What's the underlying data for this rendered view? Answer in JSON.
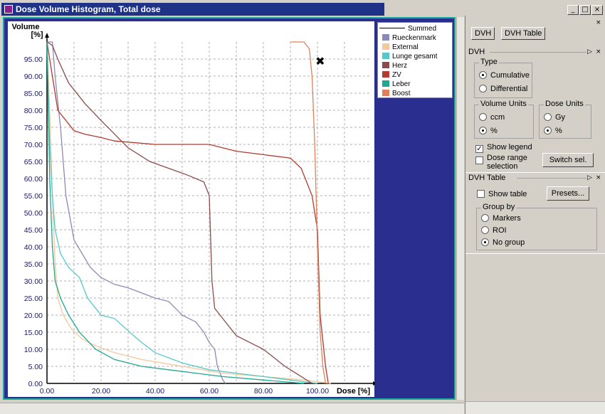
{
  "window": {
    "title": "Dose Volume Histogram, Total dose",
    "min": "_",
    "max": "□",
    "close": "×"
  },
  "chart_data": {
    "type": "line",
    "title": "",
    "xlabel": "Dose [%]",
    "ylabel": "Volume [%]",
    "xlim": [
      0,
      120
    ],
    "ylim": [
      0,
      100
    ],
    "xticks": [
      "0.00",
      "20.00",
      "40.00",
      "60.00",
      "80.00",
      "100.00"
    ],
    "yticks": [
      "0.00",
      "5.00",
      "10.00",
      "15.00",
      "20.00",
      "25.00",
      "30.00",
      "35.00",
      "40.00",
      "45.00",
      "50.00",
      "55.00",
      "60.00",
      "65.00",
      "70.00",
      "75.00",
      "80.00",
      "85.00",
      "90.00",
      "95.00"
    ],
    "grid": true,
    "legend_position": "top-right",
    "legend_title": "Summed",
    "series": [
      {
        "name": "Rueckenmark",
        "color": "#8a8ab8",
        "points": [
          [
            0,
            100
          ],
          [
            2,
            100
          ],
          [
            3,
            90
          ],
          [
            5,
            75
          ],
          [
            7,
            55
          ],
          [
            10,
            42
          ],
          [
            13,
            38
          ],
          [
            16,
            34
          ],
          [
            20,
            31
          ],
          [
            25,
            29
          ],
          [
            30,
            28
          ],
          [
            40,
            25
          ],
          [
            45,
            24
          ],
          [
            50,
            20
          ],
          [
            55,
            18
          ],
          [
            58,
            15
          ],
          [
            60,
            12
          ],
          [
            62,
            10
          ],
          [
            63,
            5
          ],
          [
            64,
            3
          ],
          [
            65,
            1
          ],
          [
            66,
            0
          ]
        ]
      },
      {
        "name": "External",
        "color": "#f4c89a",
        "points": [
          [
            0,
            100
          ],
          [
            1,
            80
          ],
          [
            2,
            55
          ],
          [
            3,
            35
          ],
          [
            4,
            25
          ],
          [
            6,
            20
          ],
          [
            9,
            16
          ],
          [
            13,
            13
          ],
          [
            18,
            11
          ],
          [
            25,
            9
          ],
          [
            35,
            7
          ],
          [
            50,
            5
          ],
          [
            65,
            3
          ],
          [
            80,
            2
          ],
          [
            95,
            1
          ],
          [
            105,
            0
          ]
        ]
      },
      {
        "name": "Lunge gesamt",
        "color": "#56c8c8",
        "points": [
          [
            0,
            100
          ],
          [
            1,
            70
          ],
          [
            2,
            55
          ],
          [
            3,
            45
          ],
          [
            5,
            38
          ],
          [
            8,
            34
          ],
          [
            12,
            31
          ],
          [
            15,
            25
          ],
          [
            20,
            20
          ],
          [
            25,
            19
          ],
          [
            32,
            14
          ],
          [
            35,
            12
          ],
          [
            40,
            9
          ],
          [
            50,
            6
          ],
          [
            60,
            4
          ],
          [
            70,
            3
          ],
          [
            80,
            2
          ],
          [
            90,
            1
          ],
          [
            100,
            0
          ]
        ]
      },
      {
        "name": "Herz",
        "color": "#8c4a4a",
        "points": [
          [
            0,
            100
          ],
          [
            2,
            99
          ],
          [
            4,
            95
          ],
          [
            8,
            88
          ],
          [
            14,
            82
          ],
          [
            20,
            77
          ],
          [
            25,
            73
          ],
          [
            30,
            69
          ],
          [
            38,
            65
          ],
          [
            45,
            63
          ],
          [
            52,
            61
          ],
          [
            58,
            59
          ],
          [
            60,
            55
          ],
          [
            61,
            30
          ],
          [
            62,
            22
          ],
          [
            66,
            18
          ],
          [
            70,
            14
          ],
          [
            75,
            12
          ],
          [
            80,
            10
          ],
          [
            88,
            5
          ],
          [
            92,
            3
          ],
          [
            98,
            0
          ]
        ]
      },
      {
        "name": "ZV",
        "color": "#b23a30",
        "points": [
          [
            0,
            100
          ],
          [
            2,
            90
          ],
          [
            4,
            80
          ],
          [
            8,
            76
          ],
          [
            10,
            74
          ],
          [
            14,
            73
          ],
          [
            20,
            72
          ],
          [
            25,
            71
          ],
          [
            40,
            70
          ],
          [
            60,
            70
          ],
          [
            70,
            68
          ],
          [
            80,
            67
          ],
          [
            90,
            66
          ],
          [
            94,
            63
          ],
          [
            98,
            55
          ],
          [
            100,
            45
          ],
          [
            101,
            20
          ],
          [
            103,
            5
          ],
          [
            104,
            0
          ]
        ]
      },
      {
        "name": "Leber",
        "color": "#20a890",
        "points": [
          [
            0,
            100
          ],
          [
            1,
            60
          ],
          [
            2,
            40
          ],
          [
            3,
            30
          ],
          [
            5,
            25
          ],
          [
            8,
            20
          ],
          [
            12,
            15
          ],
          [
            18,
            10
          ],
          [
            25,
            7
          ],
          [
            35,
            5
          ],
          [
            45,
            4
          ],
          [
            55,
            3
          ],
          [
            65,
            2
          ],
          [
            80,
            1
          ],
          [
            95,
            0
          ]
        ]
      },
      {
        "name": "Boost",
        "color": "#e0805a",
        "points": [
          [
            90,
            100
          ],
          [
            95,
            100
          ],
          [
            97,
            98
          ],
          [
            98,
            90
          ],
          [
            99,
            70
          ],
          [
            100,
            40
          ],
          [
            101,
            15
          ],
          [
            102,
            5
          ],
          [
            103,
            0
          ]
        ]
      }
    ],
    "marker": {
      "x": 101,
      "y": 94.5,
      "symbol": "✖"
    }
  },
  "panel": {
    "tabs": [
      "DVH",
      "DVH Table"
    ],
    "dvh_section": "DVH",
    "type_group": "Type",
    "type_options": [
      "Cumulative",
      "Differential"
    ],
    "volume_units_group": "Volume Units",
    "volume_options": [
      "ccm",
      "%"
    ],
    "dose_units_group": "Dose Units",
    "dose_options": [
      "Gy",
      "%"
    ],
    "show_legend": "Show legend",
    "dose_range": "Dose range selection",
    "switch_sel": "Switch sel.",
    "table_section": "DVH Table",
    "show_table": "Show table",
    "presets": "Presets...",
    "group_by": "Group by",
    "group_options": [
      "Markers",
      "ROI",
      "No group"
    ],
    "pin": "▷",
    "close": "×"
  }
}
